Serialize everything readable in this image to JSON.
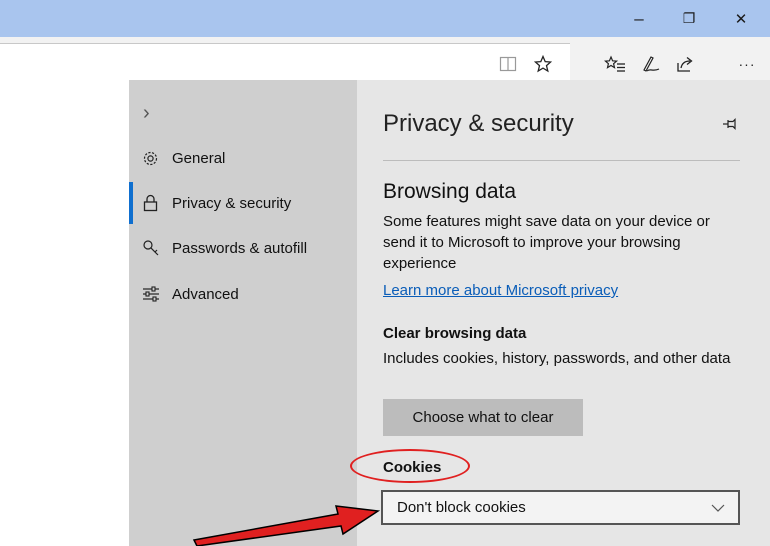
{
  "window": {
    "minimize_symbol": "–",
    "restore_symbol": "❐",
    "close_symbol": "✕"
  },
  "toolbar": {
    "more_symbol": "···"
  },
  "nav": {
    "collapse_symbol": "›",
    "items": [
      {
        "label": "General",
        "icon": "gear-icon"
      },
      {
        "label": "Privacy & security",
        "icon": "lock-icon",
        "active": true
      },
      {
        "label": "Passwords & autofill",
        "icon": "key-icon"
      },
      {
        "label": "Advanced",
        "icon": "sliders-icon"
      }
    ]
  },
  "panel": {
    "title": "Privacy & security",
    "browsing_data_heading": "Browsing data",
    "browsing_data_desc": "Some features might save data on your device or send it to Microsoft to improve your browsing experience",
    "learn_more_link": "Learn more about Microsoft privacy",
    "clear_heading": "Clear browsing data",
    "clear_desc": "Includes cookies, history, passwords, and other data",
    "clear_button": "Choose what to clear",
    "cookies_label": "Cookies",
    "cookies_value": "Don't block cookies"
  },
  "colors": {
    "accent": "#0f6fcf",
    "annotation": "#e02020",
    "titlebar": "#a9c5ee"
  }
}
